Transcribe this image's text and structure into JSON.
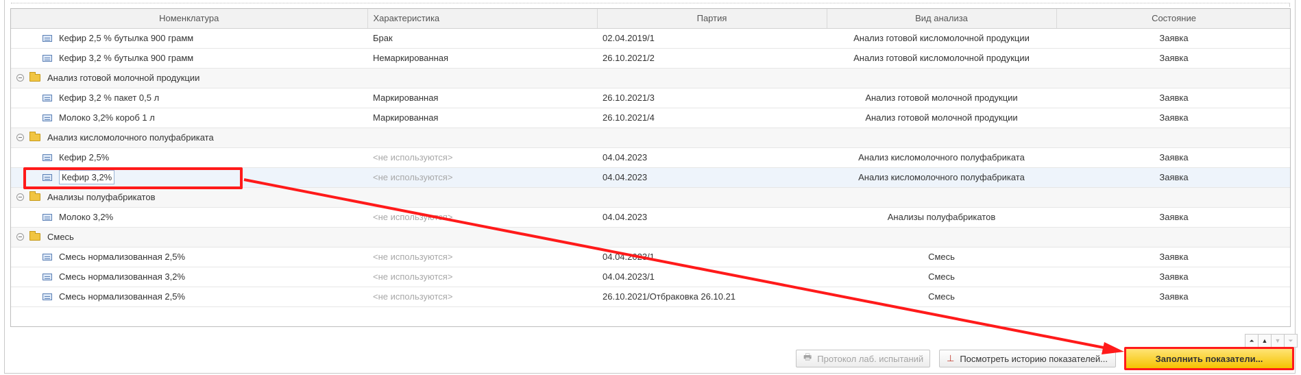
{
  "columns": [
    "Номенклатура",
    "Характеристика",
    "Партия",
    "Вид анализа",
    "Состояние"
  ],
  "rows": [
    {
      "kind": "item",
      "nom": "Кефир 2,5 % бутылка 900 грамм",
      "char": "Брак",
      "char_muted": false,
      "batch": "02.04.2019/1",
      "analysis": "Анализ готовой кисломолочной продукции",
      "state": "Заявка"
    },
    {
      "kind": "item",
      "nom": "Кефир 3,2 % бутылка 900 грамм",
      "char": "Немаркированная",
      "char_muted": false,
      "batch": "26.10.2021/2",
      "analysis": "Анализ готовой кисломолочной продукции",
      "state": "Заявка"
    },
    {
      "kind": "group",
      "nom": "Анализ готовой молочной продукции"
    },
    {
      "kind": "item",
      "nom": "Кефир 3,2 % пакет 0,5 л",
      "char": "Маркированная",
      "char_muted": false,
      "batch": "26.10.2021/3",
      "analysis": "Анализ готовой молочной продукции",
      "state": "Заявка"
    },
    {
      "kind": "item",
      "nom": "Молоко 3,2% короб 1 л",
      "char": "Маркированная",
      "char_muted": false,
      "batch": "26.10.2021/4",
      "analysis": "Анализ готовой молочной продукции",
      "state": "Заявка"
    },
    {
      "kind": "group",
      "nom": "Анализ кисломолочного полуфабриката"
    },
    {
      "kind": "item",
      "nom": "Кефир 2,5%",
      "char": "<не используются>",
      "char_muted": true,
      "batch": "04.04.2023",
      "analysis": "Анализ кисломолочного полуфабриката",
      "state": "Заявка"
    },
    {
      "kind": "item",
      "selected": true,
      "nom": "Кефир 3,2%",
      "char": "<не используются>",
      "char_muted": true,
      "batch": "04.04.2023",
      "analysis": "Анализ кисломолочного полуфабриката",
      "state": "Заявка"
    },
    {
      "kind": "group",
      "nom": "Анализы полуфабрикатов"
    },
    {
      "kind": "item",
      "nom": "Молоко 3,2%",
      "char": "<не используются>",
      "char_muted": true,
      "batch": "04.04.2023",
      "analysis": "Анализы полуфабрикатов",
      "state": "Заявка"
    },
    {
      "kind": "group",
      "nom": "Смесь"
    },
    {
      "kind": "item",
      "nom": "Смесь нормализованная 2,5%",
      "char": "<не используются>",
      "char_muted": true,
      "batch": "04.04.2023/1",
      "analysis": "Смесь",
      "state": "Заявка"
    },
    {
      "kind": "item",
      "nom": "Смесь нормализованная 3,2%",
      "char": "<не используются>",
      "char_muted": true,
      "batch": "04.04.2023/1",
      "analysis": "Смесь",
      "state": "Заявка"
    },
    {
      "kind": "item",
      "nom": "Смесь нормализованная 2,5%",
      "char": "<не используются>",
      "char_muted": true,
      "batch": "26.10.2021/Отбраковка 26.10.21",
      "analysis": "Смесь",
      "state": "Заявка"
    }
  ],
  "buttons": {
    "protocol": "Протокол лаб. испытаний",
    "history": "Посмотреть историю показателей...",
    "fill": "Заполнить показатели..."
  },
  "scroll": {
    "first": "⏶",
    "up": "▲",
    "down": "▼",
    "last": "⏷"
  },
  "annotation": {
    "color": "#ff1a1a"
  }
}
